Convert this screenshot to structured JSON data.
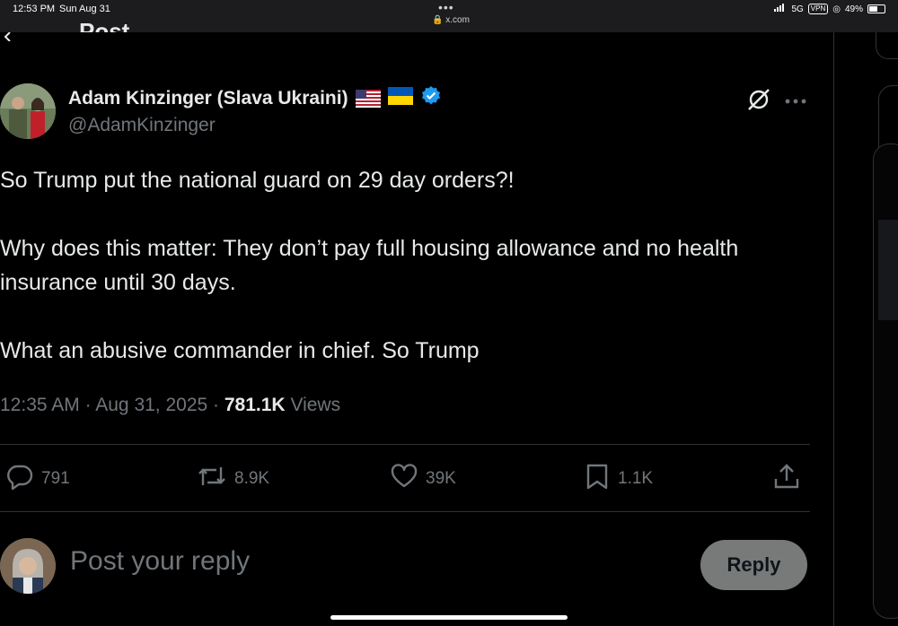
{
  "status_bar": {
    "time": "12:53 PM",
    "date": "Sun Aug 31",
    "dots": "•••",
    "url": "x.com",
    "network": "5G",
    "vpn": "VPN",
    "battery": "49%"
  },
  "header": {
    "title": "Post",
    "back_icon": "back-arrow-icon"
  },
  "tweet": {
    "author_name": "Adam Kinzinger (Slava Ukraini)",
    "handle": "@AdamKinzinger",
    "flags": [
      "us-flag-icon",
      "ukraine-flag-icon"
    ],
    "verified": true,
    "paragraphs": [
      "So Trump put the national guard on 29 day orders?!",
      "Why does this matter:   They don’t pay full housing allowance and no health insurance until 30 days.",
      "What an abusive commander in chief.  So Trump"
    ],
    "time": "12:35 AM",
    "date": "Aug 31, 2025",
    "views_count": "781.1K",
    "views_label": "Views"
  },
  "actions": {
    "replies": "791",
    "reposts": "8.9K",
    "likes": "39K",
    "bookmarks": "1.1K"
  },
  "reply": {
    "placeholder": "Post your reply",
    "button_label": "Reply"
  },
  "colors": {
    "background": "#000000",
    "text": "#e7e9ea",
    "muted": "#71767b",
    "verified": "#1d9bf0",
    "divider": "#2f3336"
  }
}
